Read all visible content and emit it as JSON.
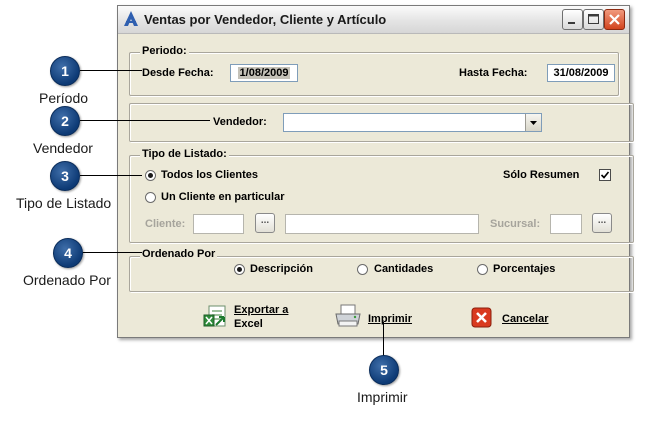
{
  "window": {
    "title": "Ventas por Vendedor, Cliente y Artículo"
  },
  "periodo": {
    "legend": "Periodo:",
    "desde_label": "Desde Fecha:",
    "desde_value": "1/08/2009",
    "hasta_label": "Hasta Fecha:",
    "hasta_value": "31/08/2009"
  },
  "vendedor": {
    "label": "Vendedor:",
    "value": ""
  },
  "tipo_listado": {
    "legend": "Tipo de Listado:",
    "options": [
      {
        "label": "Todos los Clientes",
        "selected": true
      },
      {
        "label": "Un Cliente en particular",
        "selected": false
      }
    ],
    "solo_resumen_label": "Sólo Resumen",
    "solo_resumen_checked": true,
    "cliente_label": "Cliente:",
    "cliente_button": "...",
    "sucursal_label": "Sucursal:",
    "sucursal_button": "..."
  },
  "ordenado_por": {
    "legend": "Ordenado Por",
    "options": [
      {
        "label": "Descripción",
        "selected": true
      },
      {
        "label": "Cantidades",
        "selected": false
      },
      {
        "label": "Porcentajes",
        "selected": false
      }
    ]
  },
  "actions": {
    "exportar_line1": "Exportar a",
    "exportar_line2": "Excel",
    "imprimir": "Imprimir",
    "cancelar": "Cancelar"
  },
  "callouts": [
    {
      "number": "1",
      "caption": "Período"
    },
    {
      "number": "2",
      "caption": "Vendedor"
    },
    {
      "number": "3",
      "caption": "Tipo de Listado"
    },
    {
      "number": "4",
      "caption": "Ordenado Por"
    },
    {
      "number": "5",
      "caption": "Imprimir"
    }
  ],
  "colors": {
    "window_bg": "#ece9d8",
    "callout_bg": "#0d3a75",
    "close_button": "#d2441f"
  }
}
